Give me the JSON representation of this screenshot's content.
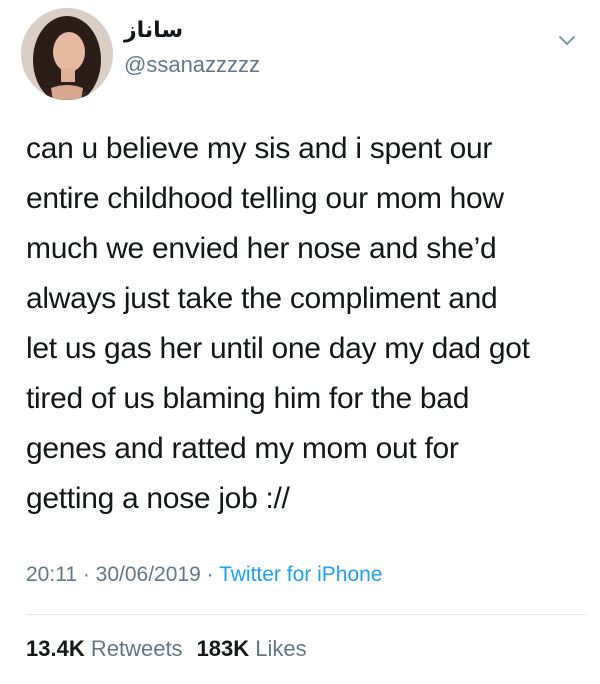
{
  "user": {
    "display_name": "ساناز",
    "handle": "@ssanazzzzz",
    "avatar_icon": "profile-photo"
  },
  "menu_icon": "chevron-down-icon",
  "tweet": {
    "lines": [
      "can u believe my sis and i spent our",
      "entire childhood telling our mom how",
      "much we envied her nose and she’d",
      "always just take the compliment and",
      "let us gas her until one day my dad got",
      "tired of us blaming him for the bad",
      "genes and ratted my mom out for",
      "getting a nose job ://"
    ]
  },
  "meta": {
    "time": "20:11",
    "separator1": " · ",
    "date": "30/06/2019",
    "separator2": " · ",
    "source": "Twitter for iPhone"
  },
  "stats": {
    "retweets_count": "13.4K",
    "retweets_label": "Retweets",
    "likes_count": "183K",
    "likes_label": "Likes"
  },
  "colors": {
    "text": "#14171a",
    "secondary": "#657786",
    "link": "#1da1f2",
    "divider": "#e1e8ed"
  }
}
